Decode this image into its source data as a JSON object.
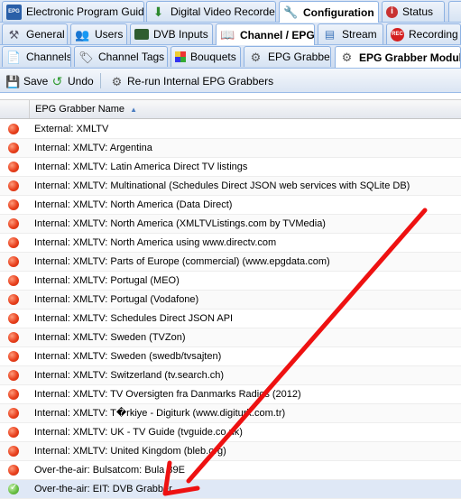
{
  "main_tabs": [
    {
      "label": "Electronic Program Guide",
      "icon": "epg-icon"
    },
    {
      "label": "Digital Video Recorder",
      "icon": "dvr-icon"
    },
    {
      "label": "Configuration",
      "icon": "wrench-icon"
    },
    {
      "label": "Status",
      "icon": "info-icon"
    }
  ],
  "config_tabs": [
    {
      "label": "General",
      "icon": "tools-icon"
    },
    {
      "label": "Users",
      "icon": "users-icon"
    },
    {
      "label": "DVB Inputs",
      "icon": "card-icon"
    },
    {
      "label": "Channel / EPG",
      "icon": "book-icon"
    },
    {
      "label": "Stream",
      "icon": "stream-icon"
    },
    {
      "label": "Recording",
      "icon": "rec-icon"
    }
  ],
  "sub_tabs": [
    {
      "label": "Channels",
      "icon": "channels-icon"
    },
    {
      "label": "Channel Tags",
      "icon": "tags-icon"
    },
    {
      "label": "Bouquets",
      "icon": "bouquets-icon"
    },
    {
      "label": "EPG Grabber",
      "icon": "epg-grabber-icon"
    },
    {
      "label": "EPG Grabber Module",
      "icon": "module-icon"
    }
  ],
  "toolbar": {
    "save_label": "Save",
    "undo_label": "Undo",
    "rerun_label": "Re-run Internal EPG Grabbers"
  },
  "grid": {
    "column_header": "EPG Grabber Name",
    "sort_icon": "sort-asc-icon",
    "rows": [
      {
        "label": "External: XMLTV",
        "status": "disabled"
      },
      {
        "label": "Internal: XMLTV: Argentina",
        "status": "disabled"
      },
      {
        "label": "Internal: XMLTV: Latin America Direct TV listings",
        "status": "disabled"
      },
      {
        "label": "Internal: XMLTV: Multinational (Schedules Direct JSON web services with SQLite DB)",
        "status": "disabled"
      },
      {
        "label": "Internal: XMLTV: North America (Data Direct)",
        "status": "disabled"
      },
      {
        "label": "Internal: XMLTV: North America (XMLTVListings.com by TVMedia)",
        "status": "disabled"
      },
      {
        "label": "Internal: XMLTV: North America using www.directv.com",
        "status": "disabled"
      },
      {
        "label": "Internal: XMLTV: Parts of Europe (commercial) (www.epgdata.com)",
        "status": "disabled"
      },
      {
        "label": "Internal: XMLTV: Portugal (MEO)",
        "status": "disabled"
      },
      {
        "label": "Internal: XMLTV: Portugal (Vodafone)",
        "status": "disabled"
      },
      {
        "label": "Internal: XMLTV: Schedules Direct JSON API",
        "status": "disabled"
      },
      {
        "label": "Internal: XMLTV: Sweden (TVZon)",
        "status": "disabled"
      },
      {
        "label": "Internal: XMLTV: Sweden (swedb/tvsajten)",
        "status": "disabled"
      },
      {
        "label": "Internal: XMLTV: Switzerland (tv.search.ch)",
        "status": "disabled"
      },
      {
        "label": "Internal: XMLTV: TV Oversigten fra Danmarks Radios (2012)",
        "status": "disabled"
      },
      {
        "label": "Internal: XMLTV: T�rkiye - Digiturk (www.digiturk.com.tr)",
        "status": "disabled"
      },
      {
        "label": "Internal: XMLTV: UK - TV Guide (tvguide.co.uk)",
        "status": "disabled"
      },
      {
        "label": "Internal: XMLTV: United Kingdom (bleb.org)",
        "status": "disabled"
      },
      {
        "label": "Over-the-air: Bulsatcom: Bula 39E",
        "status": "disabled"
      },
      {
        "label": "Over-the-air: EIT: DVB Grabber",
        "status": "enabled"
      }
    ]
  },
  "colors": {
    "accent": "#99bbe8",
    "status_disabled": "#e8401d",
    "status_enabled": "#6bc046",
    "annotation_arrow": "#ee1111"
  }
}
